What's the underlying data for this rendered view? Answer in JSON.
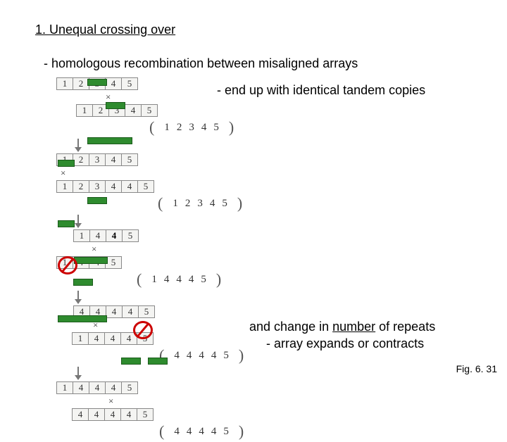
{
  "title": "1. Unequal crossing over",
  "sub1": "- homologous recombination between misaligned arrays",
  "sub2": "- end up with identical tandem copies",
  "sub3a": "and change in ",
  "sub3b": "number",
  "sub3c": " of repeats",
  "sub4": "- array expands or contracts",
  "fig": "Fig. 6. 31",
  "rows": {
    "a1": [
      "1",
      "2",
      "3",
      "4",
      "5"
    ],
    "a2": [
      "1",
      "2",
      "3",
      "4",
      "5"
    ],
    "p1": [
      "1",
      "2",
      "3",
      "4",
      "5"
    ],
    "b1": [
      "1",
      "2",
      "3",
      "4",
      "5"
    ],
    "b2": [
      "1",
      "2",
      "3",
      "4",
      "4",
      "5"
    ],
    "p2": [
      "1",
      "2",
      "3",
      "4",
      "5"
    ],
    "c1": [
      "1",
      "4",
      "4",
      "5"
    ],
    "c2": [
      "1",
      "4",
      "4",
      "5"
    ],
    "p3": [
      "1",
      "4",
      "4",
      "4",
      "5"
    ],
    "d1": [
      "4",
      "4",
      "4",
      "4",
      "5"
    ],
    "d2": [
      "1",
      "4",
      "4",
      "4",
      "5"
    ],
    "p4": [
      "4",
      "4",
      "4",
      "4",
      "5"
    ],
    "e1": [
      "1",
      "4",
      "4",
      "4",
      "5"
    ],
    "e2": [
      "4",
      "4",
      "4",
      "4",
      "5"
    ],
    "p5": [
      "4",
      "4",
      "4",
      "4",
      "5"
    ]
  }
}
